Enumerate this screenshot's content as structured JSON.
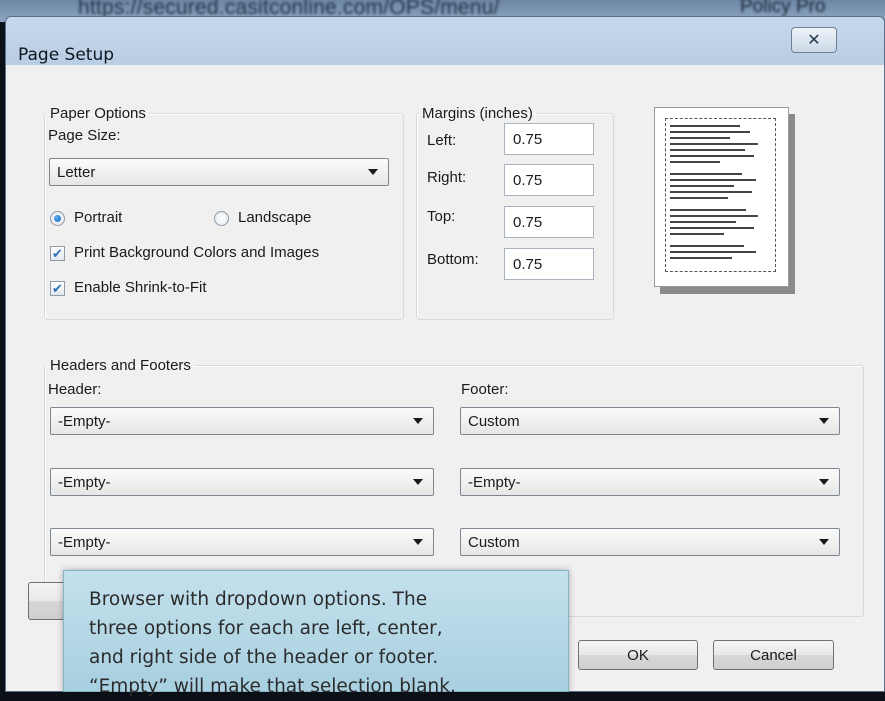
{
  "background": {
    "url_text": "https://secured.casitconline.com/OPS/menu/",
    "tab_text": "Policy Pro"
  },
  "dialog": {
    "title": "Page Setup",
    "close_glyph": "✕"
  },
  "paper_options": {
    "legend": "Paper Options",
    "page_size_label": "Page Size:",
    "page_size_value": "Letter",
    "portrait_label": "Portrait",
    "landscape_label": "Landscape",
    "orientation_selected": "Portrait",
    "print_background_label": "Print Background Colors and Images",
    "print_background_checked": true,
    "shrink_label": "Enable Shrink-to-Fit",
    "shrink_checked": true
  },
  "margins": {
    "legend": "Margins (inches)",
    "left_label": "Left:",
    "left_value": "0.75",
    "right_label": "Right:",
    "right_value": "0.75",
    "top_label": "Top:",
    "top_value": "0.75",
    "bottom_label": "Bottom:",
    "bottom_value": "0.75"
  },
  "headers_footers": {
    "legend": "Headers and Footers",
    "header_label": "Header:",
    "footer_label": "Footer:",
    "header_left": "-Empty-",
    "header_center": "-Empty-",
    "header_right": "-Empty-",
    "footer_left": "Custom",
    "footer_center": "-Empty-",
    "footer_right": "Custom"
  },
  "buttons": {
    "ok": "OK",
    "cancel": "Cancel"
  },
  "callout": {
    "line1": "Browser with dropdown options.  The",
    "line2": "three options for each are left, center,",
    "line3": "and right side of the header or footer.",
    "line4": "“Empty” will make that selection blank."
  },
  "colors": {
    "accent_radio": "#1763b6",
    "callout_bg": "#b4d8e6",
    "titlebar": "#c6d8ec"
  }
}
